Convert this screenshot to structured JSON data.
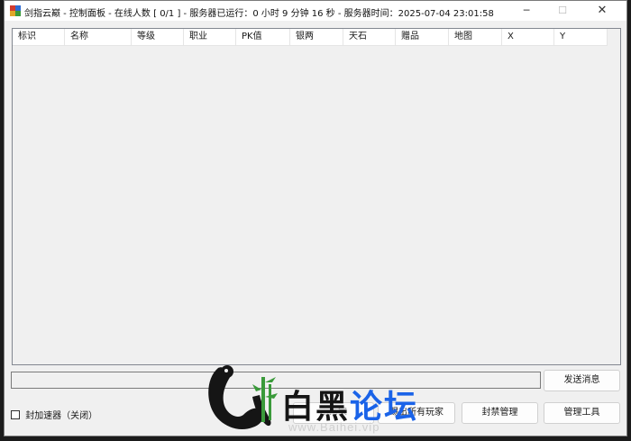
{
  "window": {
    "title": "剑指云巅 - 控制面板 - 在线人数 [ 0/1 ] - 服务器已运行：0 小时 9 分钟 16 秒  - 服务器时间：2025-07-04 23:01:58",
    "minimize": "─",
    "maximize": "☐",
    "close": "✕"
  },
  "player_list": {
    "columns": [
      "标识",
      "名称",
      "等级",
      "职业",
      "PK值",
      "银两",
      "天石",
      "赠品",
      "地图",
      "X",
      "Y"
    ],
    "rows": []
  },
  "message_input": {
    "value": ""
  },
  "buttons": {
    "send_message": "发送消息",
    "kick_all_players": "踢出所有玩家",
    "ban_management": "封禁管理",
    "admin_tools": "管理工具",
    "partially_hidden_button": "……家"
  },
  "accelerator_checkbox": {
    "label": "封加速器（关闭）",
    "checked": false
  },
  "watermark": {
    "title_black": "白黑",
    "title_blue": "论坛",
    "url": "www.Baihei.vip"
  },
  "colors": {
    "watermark_blue": "#1a63e8",
    "watermark_black": "#151515"
  }
}
